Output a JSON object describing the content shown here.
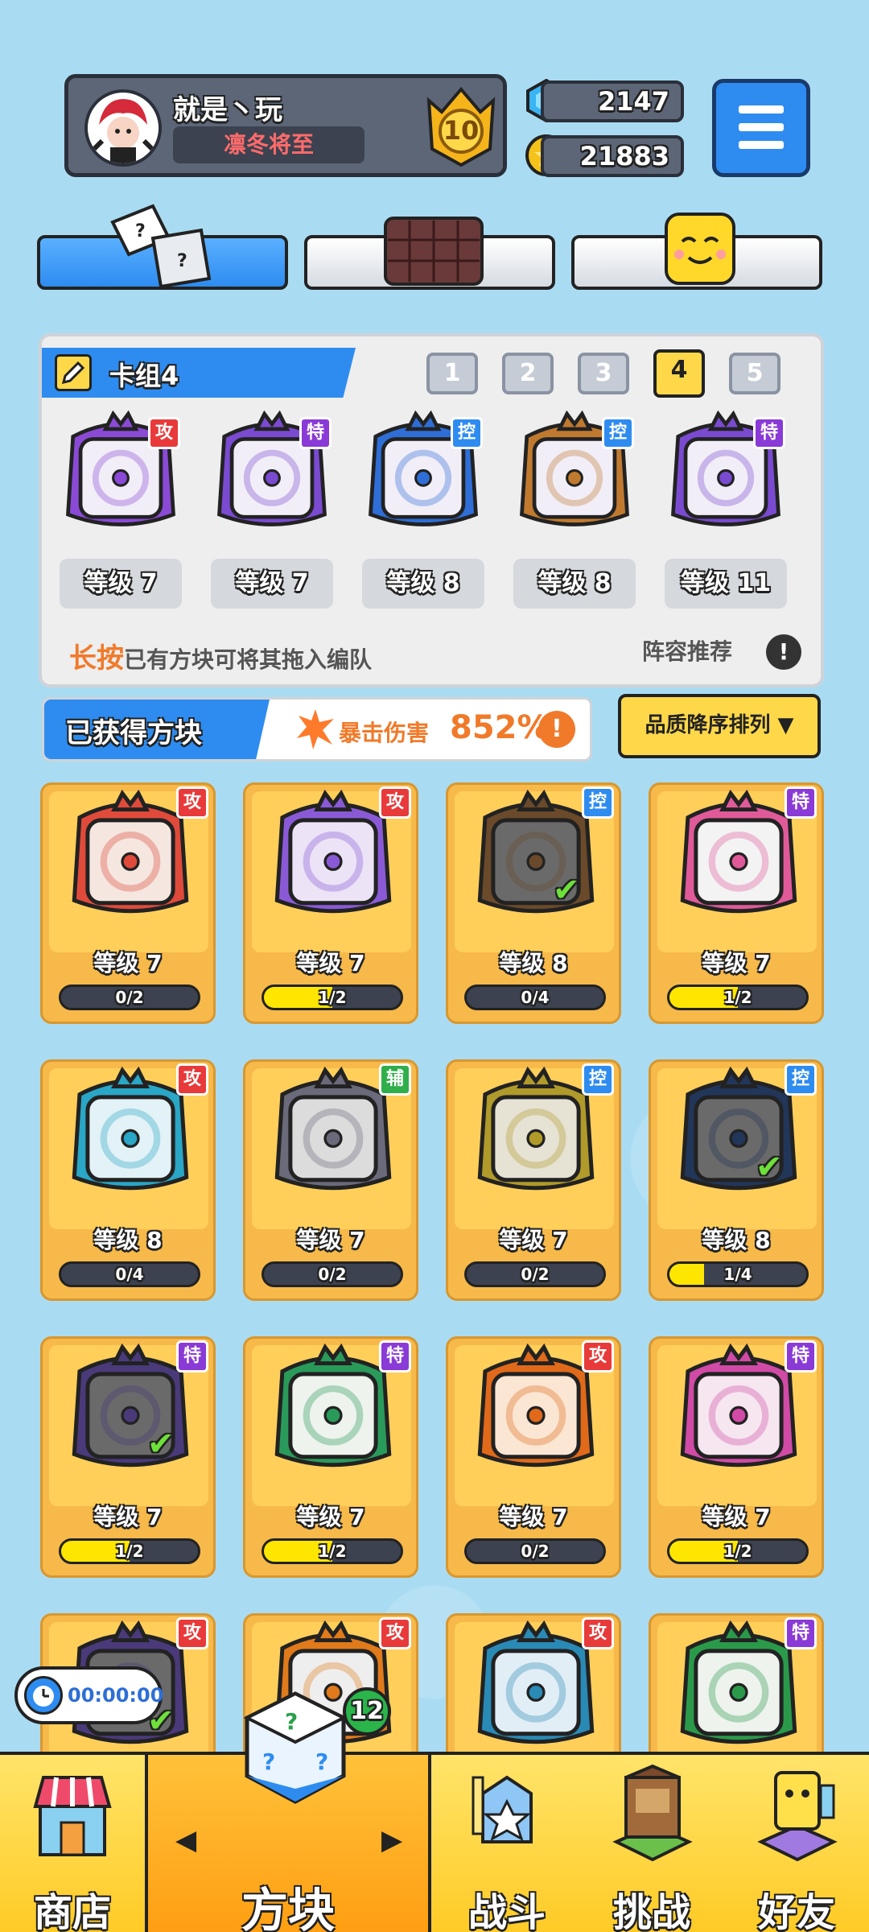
{
  "header": {
    "player_name": "就是丶玩",
    "player_title": "凛冬将至",
    "rank_level": "10",
    "gems": "2147",
    "coins": "21883"
  },
  "colors": {
    "accent": "#2e8cf0",
    "gold": "#ffd84a",
    "attack": "#e83a3a",
    "control": "#2e8cf0",
    "special": "#8a3ad6",
    "support": "#2fae4a"
  },
  "deck": {
    "title": "卡组4",
    "numbers": [
      "1",
      "2",
      "3",
      "4",
      "5"
    ],
    "active_index": 3,
    "cards": [
      {
        "tag": "攻",
        "level": "等级 7",
        "color": "#8a4ad6",
        "icon": "mandala-dice-icon"
      },
      {
        "tag": "特",
        "level": "等级 7",
        "color": "#7a4ad0",
        "icon": "swirl-dice-icon"
      },
      {
        "tag": "控",
        "level": "等级 8",
        "color": "#2e6ed6",
        "icon": "snowflake-dice-icon"
      },
      {
        "tag": "控",
        "level": "等级 8",
        "color": "#c07a30",
        "icon": "sand-dice-icon"
      },
      {
        "tag": "特",
        "level": "等级 11",
        "color": "#7a4ad0",
        "icon": "crack-dice-icon"
      }
    ],
    "hint_emphasis": "长按",
    "hint_text": "已有方块可将其拖入编队",
    "recommend_label": "阵容推荐",
    "recommend_icon": "!"
  },
  "owned": {
    "title": "已获得方块",
    "crit_label": "暴击伤害",
    "crit_value": "852%",
    "sort_label": "品质降序排列 ▼",
    "cards": [
      {
        "tag": "攻",
        "level": "等级 7",
        "progress": "0/2",
        "fill": 0,
        "color": "#e04a3a",
        "face": "#f5e6e0",
        "check": false
      },
      {
        "tag": "攻",
        "level": "等级 7",
        "progress": "1/2",
        "fill": 0.5,
        "color": "#8a5ad6",
        "face": "#ece4f6",
        "check": false
      },
      {
        "tag": "控",
        "level": "等级 8",
        "progress": "0/4",
        "fill": 0,
        "color": "#6a4a2a",
        "face": "#6a6a6a",
        "check": true
      },
      {
        "tag": "特",
        "level": "等级 7",
        "progress": "1/2",
        "fill": 0.5,
        "color": "#e05a9a",
        "face": "#f3f3f3",
        "check": false
      },
      {
        "tag": "攻",
        "level": "等级 8",
        "progress": "0/4",
        "fill": 0,
        "color": "#2aa6c6",
        "face": "#e2f2f6",
        "check": false
      },
      {
        "tag": "辅",
        "level": "等级 7",
        "progress": "0/2",
        "fill": 0,
        "color": "#6a6a7a",
        "face": "#dcdcdc",
        "check": false
      },
      {
        "tag": "控",
        "level": "等级 7",
        "progress": "0/2",
        "fill": 0,
        "color": "#b09a2a",
        "face": "#e6e2d4",
        "check": false
      },
      {
        "tag": "控",
        "level": "等级 8",
        "progress": "1/4",
        "fill": 0.25,
        "color": "#22365a",
        "face": "#6a6a6a",
        "check": true
      },
      {
        "tag": "特",
        "level": "等级 7",
        "progress": "1/2",
        "fill": 0.5,
        "color": "#4a3a7a",
        "face": "#6a6a6a",
        "check": true
      },
      {
        "tag": "特",
        "level": "等级 7",
        "progress": "1/2",
        "fill": 0.5,
        "color": "#2a9a5a",
        "face": "#eef3ee",
        "check": false
      },
      {
        "tag": "攻",
        "level": "等级 7",
        "progress": "0/2",
        "fill": 0,
        "color": "#e06a1a",
        "face": "#fbe6d4",
        "check": false
      },
      {
        "tag": "特",
        "level": "等级 7",
        "progress": "1/2",
        "fill": 0.5,
        "color": "#d04aa6",
        "face": "#f6e6f0",
        "check": false
      },
      {
        "tag": "攻",
        "level": "",
        "progress": "",
        "fill": 0,
        "color": "#4a3a7a",
        "face": "#6a6a6a",
        "check": true
      },
      {
        "tag": "攻",
        "level": "",
        "progress": "",
        "fill": 0,
        "color": "#e07a1a",
        "face": "#eeeeee",
        "check": false
      },
      {
        "tag": "攻",
        "level": "",
        "progress": "",
        "fill": 0,
        "color": "#2a8ab6",
        "face": "#e2eef6",
        "check": false
      },
      {
        "tag": "特",
        "level": "",
        "progress": "",
        "fill": 0,
        "color": "#2a9a4a",
        "face": "#eef3ee",
        "check": false
      }
    ]
  },
  "timer": {
    "value": "00:00:00"
  },
  "nav": {
    "shop": "商店",
    "blocks": "方块",
    "blocks_badge": "12",
    "battle": "战斗",
    "challenge": "挑战",
    "friends": "好友"
  }
}
